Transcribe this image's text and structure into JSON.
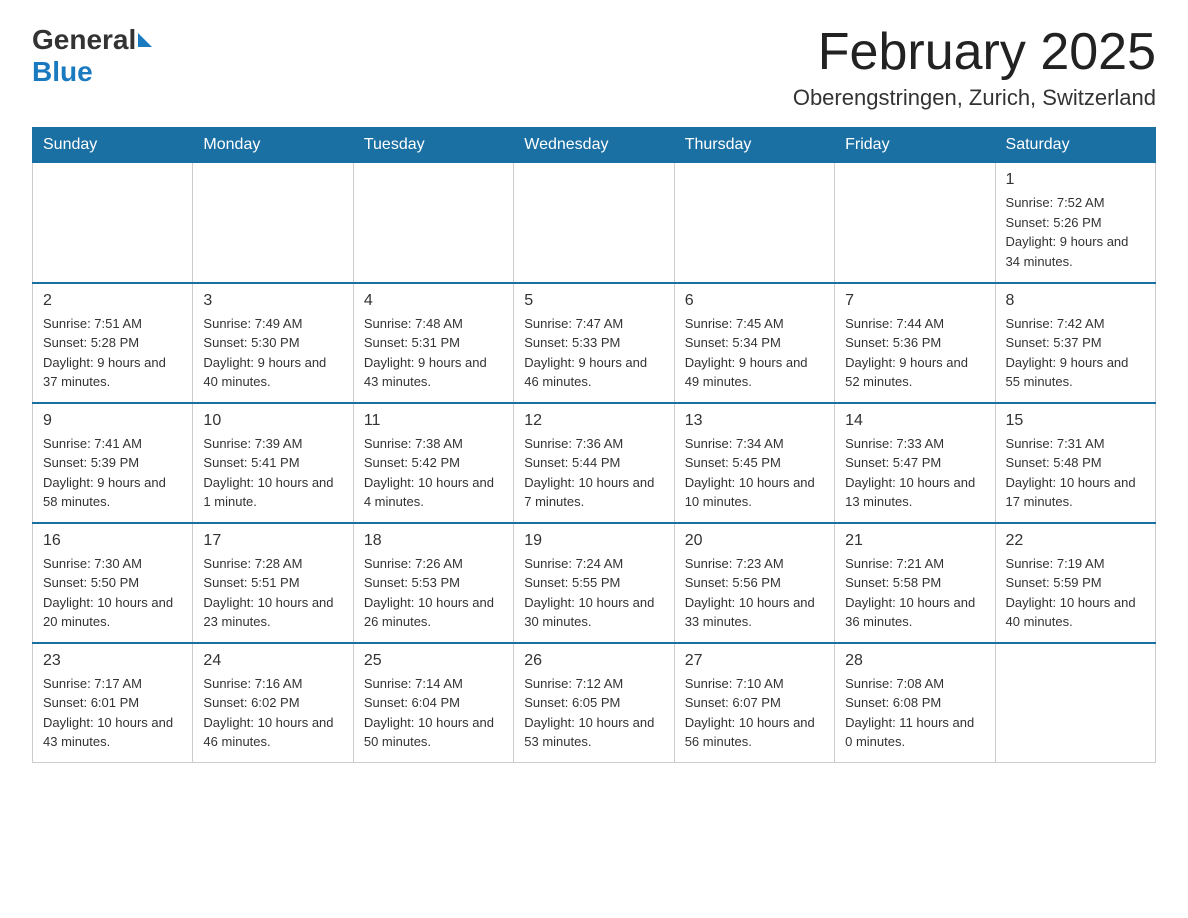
{
  "header": {
    "logo_general": "General",
    "logo_blue": "Blue",
    "month_title": "February 2025",
    "location": "Oberengstringen, Zurich, Switzerland"
  },
  "days_of_week": [
    "Sunday",
    "Monday",
    "Tuesday",
    "Wednesday",
    "Thursday",
    "Friday",
    "Saturday"
  ],
  "weeks": [
    [
      {
        "day": "",
        "info": ""
      },
      {
        "day": "",
        "info": ""
      },
      {
        "day": "",
        "info": ""
      },
      {
        "day": "",
        "info": ""
      },
      {
        "day": "",
        "info": ""
      },
      {
        "day": "",
        "info": ""
      },
      {
        "day": "1",
        "info": "Sunrise: 7:52 AM\nSunset: 5:26 PM\nDaylight: 9 hours and 34 minutes."
      }
    ],
    [
      {
        "day": "2",
        "info": "Sunrise: 7:51 AM\nSunset: 5:28 PM\nDaylight: 9 hours and 37 minutes."
      },
      {
        "day": "3",
        "info": "Sunrise: 7:49 AM\nSunset: 5:30 PM\nDaylight: 9 hours and 40 minutes."
      },
      {
        "day": "4",
        "info": "Sunrise: 7:48 AM\nSunset: 5:31 PM\nDaylight: 9 hours and 43 minutes."
      },
      {
        "day": "5",
        "info": "Sunrise: 7:47 AM\nSunset: 5:33 PM\nDaylight: 9 hours and 46 minutes."
      },
      {
        "day": "6",
        "info": "Sunrise: 7:45 AM\nSunset: 5:34 PM\nDaylight: 9 hours and 49 minutes."
      },
      {
        "day": "7",
        "info": "Sunrise: 7:44 AM\nSunset: 5:36 PM\nDaylight: 9 hours and 52 minutes."
      },
      {
        "day": "8",
        "info": "Sunrise: 7:42 AM\nSunset: 5:37 PM\nDaylight: 9 hours and 55 minutes."
      }
    ],
    [
      {
        "day": "9",
        "info": "Sunrise: 7:41 AM\nSunset: 5:39 PM\nDaylight: 9 hours and 58 minutes."
      },
      {
        "day": "10",
        "info": "Sunrise: 7:39 AM\nSunset: 5:41 PM\nDaylight: 10 hours and 1 minute."
      },
      {
        "day": "11",
        "info": "Sunrise: 7:38 AM\nSunset: 5:42 PM\nDaylight: 10 hours and 4 minutes."
      },
      {
        "day": "12",
        "info": "Sunrise: 7:36 AM\nSunset: 5:44 PM\nDaylight: 10 hours and 7 minutes."
      },
      {
        "day": "13",
        "info": "Sunrise: 7:34 AM\nSunset: 5:45 PM\nDaylight: 10 hours and 10 minutes."
      },
      {
        "day": "14",
        "info": "Sunrise: 7:33 AM\nSunset: 5:47 PM\nDaylight: 10 hours and 13 minutes."
      },
      {
        "day": "15",
        "info": "Sunrise: 7:31 AM\nSunset: 5:48 PM\nDaylight: 10 hours and 17 minutes."
      }
    ],
    [
      {
        "day": "16",
        "info": "Sunrise: 7:30 AM\nSunset: 5:50 PM\nDaylight: 10 hours and 20 minutes."
      },
      {
        "day": "17",
        "info": "Sunrise: 7:28 AM\nSunset: 5:51 PM\nDaylight: 10 hours and 23 minutes."
      },
      {
        "day": "18",
        "info": "Sunrise: 7:26 AM\nSunset: 5:53 PM\nDaylight: 10 hours and 26 minutes."
      },
      {
        "day": "19",
        "info": "Sunrise: 7:24 AM\nSunset: 5:55 PM\nDaylight: 10 hours and 30 minutes."
      },
      {
        "day": "20",
        "info": "Sunrise: 7:23 AM\nSunset: 5:56 PM\nDaylight: 10 hours and 33 minutes."
      },
      {
        "day": "21",
        "info": "Sunrise: 7:21 AM\nSunset: 5:58 PM\nDaylight: 10 hours and 36 minutes."
      },
      {
        "day": "22",
        "info": "Sunrise: 7:19 AM\nSunset: 5:59 PM\nDaylight: 10 hours and 40 minutes."
      }
    ],
    [
      {
        "day": "23",
        "info": "Sunrise: 7:17 AM\nSunset: 6:01 PM\nDaylight: 10 hours and 43 minutes."
      },
      {
        "day": "24",
        "info": "Sunrise: 7:16 AM\nSunset: 6:02 PM\nDaylight: 10 hours and 46 minutes."
      },
      {
        "day": "25",
        "info": "Sunrise: 7:14 AM\nSunset: 6:04 PM\nDaylight: 10 hours and 50 minutes."
      },
      {
        "day": "26",
        "info": "Sunrise: 7:12 AM\nSunset: 6:05 PM\nDaylight: 10 hours and 53 minutes."
      },
      {
        "day": "27",
        "info": "Sunrise: 7:10 AM\nSunset: 6:07 PM\nDaylight: 10 hours and 56 minutes."
      },
      {
        "day": "28",
        "info": "Sunrise: 7:08 AM\nSunset: 6:08 PM\nDaylight: 11 hours and 0 minutes."
      },
      {
        "day": "",
        "info": ""
      }
    ]
  ]
}
